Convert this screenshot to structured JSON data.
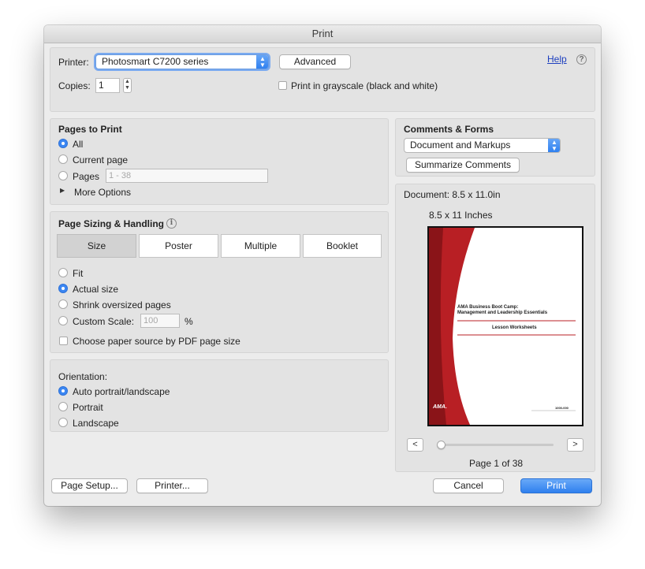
{
  "window": {
    "title": "Print"
  },
  "colors": {
    "accent": "#3b86f2",
    "brand_red": "#b81f24",
    "link": "#1d3fbf"
  },
  "header": {
    "printer_label": "Printer:",
    "printer_value": "Photosmart C7200 series",
    "advanced_label": "Advanced",
    "help_label": "Help",
    "help_icon": "question-icon",
    "copies_label": "Copies:",
    "copies_value": "1",
    "grayscale_label": "Print in grayscale (black and white)"
  },
  "pages_to_print": {
    "title": "Pages to Print",
    "all_label": "All",
    "current_label": "Current page",
    "pages_label": "Pages",
    "pages_placeholder": "1 - 38",
    "more_options_label": "More Options",
    "selected": "all"
  },
  "sizing": {
    "title": "Page Sizing & Handling",
    "info_icon": "info-icon",
    "tabs": [
      "Size",
      "Poster",
      "Multiple",
      "Booklet"
    ],
    "active_tab": "Size",
    "fit_label": "Fit",
    "actual_label": "Actual size",
    "shrink_label": "Shrink oversized pages",
    "custom_label": "Custom Scale:",
    "custom_value": "100",
    "custom_unit": "%",
    "paper_source_label": "Choose paper source by PDF page size",
    "selected": "actual"
  },
  "orientation": {
    "title": "Orientation:",
    "auto_label": "Auto portrait/landscape",
    "portrait_label": "Portrait",
    "landscape_label": "Landscape",
    "selected": "auto"
  },
  "comments": {
    "title": "Comments & Forms",
    "select_value": "Document and Markups",
    "summarize_label": "Summarize Comments"
  },
  "preview": {
    "document_label": "Document: 8.5 x 11.0in",
    "size_label": "8.5 x 11 Inches",
    "doc_title_line1": "AMA Business Boot Camp:",
    "doc_title_line2": "Management and Leadership Essentials",
    "doc_subtitle": "Lesson Worksheets",
    "doc_logo": "AMA.",
    "doc_code": "1000-000",
    "prev_label": "<",
    "next_label": ">",
    "page_label": "Page 1 of 38",
    "current_page": 1,
    "total_pages": 38
  },
  "footer": {
    "page_setup_label": "Page Setup...",
    "printer_label": "Printer...",
    "cancel_label": "Cancel",
    "print_label": "Print"
  }
}
